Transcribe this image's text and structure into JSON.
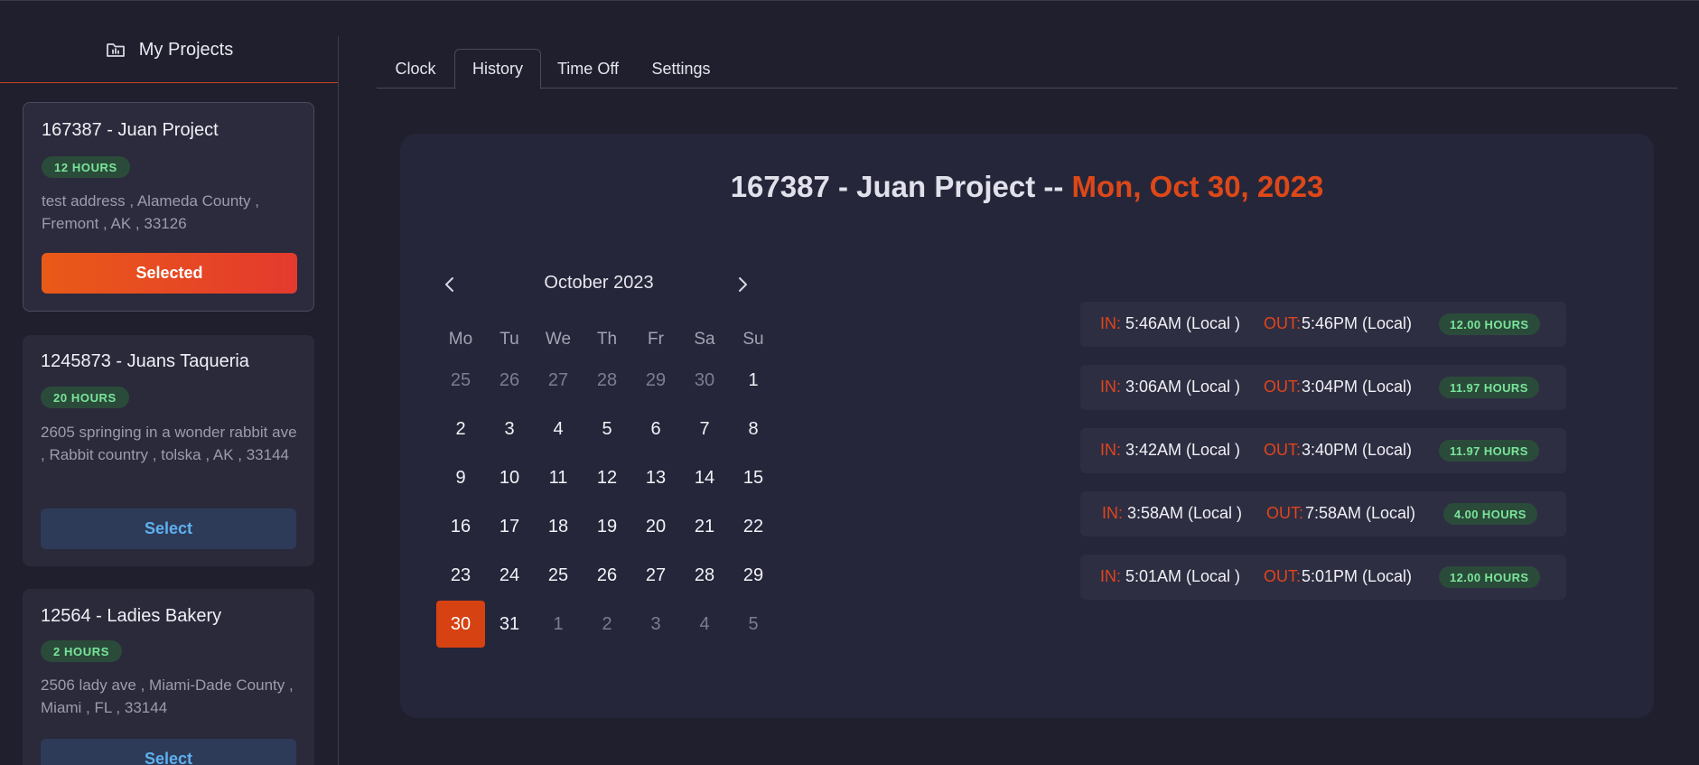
{
  "sidebar": {
    "title": "My Projects",
    "projects": [
      {
        "name": "167387 - Juan Project",
        "hours": "12 HOURS",
        "address": "test address , Alameda County , Fremont , AK , 33126",
        "button": "Selected"
      },
      {
        "name": "1245873 - Juans Taqueria",
        "hours": "20 HOURS",
        "address": "2605 springing in a wonder rabbit ave , Rabbit country , tolska , AK , 33144",
        "button": "Select"
      },
      {
        "name": "12564 - Ladies Bakery",
        "hours": "2 HOURS",
        "address": "2506 lady ave , Miami-Dade County , Miami , FL , 33144",
        "button": "Select"
      }
    ]
  },
  "tabs": [
    "Clock",
    "History",
    "Time Off",
    "Settings"
  ],
  "active_tab": "History",
  "heading": {
    "project": "167387 - Juan Project --",
    "date": "Mon, Oct 30, 2023"
  },
  "calendar": {
    "month_label": "October 2023",
    "weekdays": [
      "Mo",
      "Tu",
      "We",
      "Th",
      "Fr",
      "Sa",
      "Su"
    ],
    "weeks": [
      [
        "25",
        "26",
        "27",
        "28",
        "29",
        "30",
        "1"
      ],
      [
        "2",
        "3",
        "4",
        "5",
        "6",
        "7",
        "8"
      ],
      [
        "9",
        "10",
        "11",
        "12",
        "13",
        "14",
        "15"
      ],
      [
        "16",
        "17",
        "18",
        "19",
        "20",
        "21",
        "22"
      ],
      [
        "23",
        "24",
        "25",
        "26",
        "27",
        "28",
        "29"
      ],
      [
        "30",
        "31",
        "1",
        "2",
        "3",
        "4",
        "5"
      ]
    ],
    "selected_day": "30"
  },
  "entries": [
    {
      "in_label": "IN:",
      "in_time": "5:46AM (Local )",
      "out_label": "OUT:",
      "out_time": "5:46PM (Local)",
      "hours": "12.00 HOURS"
    },
    {
      "in_label": "IN:",
      "in_time": "3:06AM (Local )",
      "out_label": "OUT:",
      "out_time": "3:04PM (Local)",
      "hours": "11.97 HOURS"
    },
    {
      "in_label": "IN:",
      "in_time": "3:42AM (Local )",
      "out_label": "OUT:",
      "out_time": "3:40PM (Local)",
      "hours": "11.97 HOURS"
    },
    {
      "in_label": "IN:",
      "in_time": "3:58AM (Local )",
      "out_label": "OUT:",
      "out_time": "7:58AM (Local)",
      "hours": "4.00 HOURS"
    },
    {
      "in_label": "IN:",
      "in_time": "5:01AM (Local )",
      "out_label": "OUT:",
      "out_time": "5:01PM (Local)",
      "hours": "12.00 HOURS"
    }
  ],
  "colors": {
    "accent": "#dd4818",
    "hours_text": "#79e59a",
    "select_text": "#5fb0f0"
  },
  "icons": {
    "sidebar_header": "folder-chart-icon",
    "prev": "chevron-left-icon",
    "next": "chevron-right-icon"
  }
}
